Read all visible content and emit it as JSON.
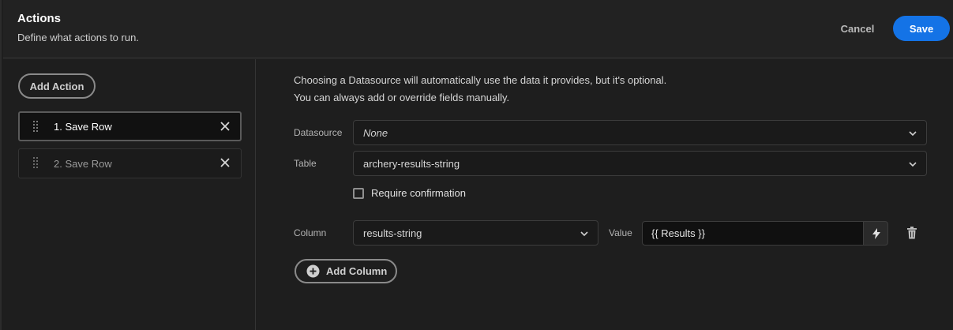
{
  "header": {
    "title": "Actions",
    "subtitle": "Define what actions to run.",
    "cancel_label": "Cancel",
    "save_label": "Save"
  },
  "sidebar": {
    "add_action_label": "Add Action",
    "actions": [
      {
        "label": "1. Save Row",
        "selected": true
      },
      {
        "label": "2. Save Row",
        "selected": false
      }
    ]
  },
  "main": {
    "info_line1": "Choosing a Datasource will automatically use the data it provides, but it's optional.",
    "info_line2": "You can always add or override fields manually.",
    "datasource": {
      "label": "Datasource",
      "value": "None"
    },
    "table": {
      "label": "Table",
      "value": "archery-results-string"
    },
    "require_confirmation": {
      "label": "Require confirmation",
      "checked": false
    },
    "column": {
      "label": "Column",
      "value": "results-string"
    },
    "value": {
      "label": "Value",
      "value": "{{ Results }}"
    },
    "add_column_label": "Add Column"
  },
  "colors": {
    "accent": "#1473e6",
    "background": "#1e1e1e",
    "header_background": "#222222"
  },
  "icons": {
    "drag": "drag-handle-icon",
    "remove": "close-icon",
    "chevron": "chevron-down-icon",
    "bolt": "lightning-bolt-icon",
    "trash": "trash-icon",
    "plus": "plus-circle-icon"
  }
}
